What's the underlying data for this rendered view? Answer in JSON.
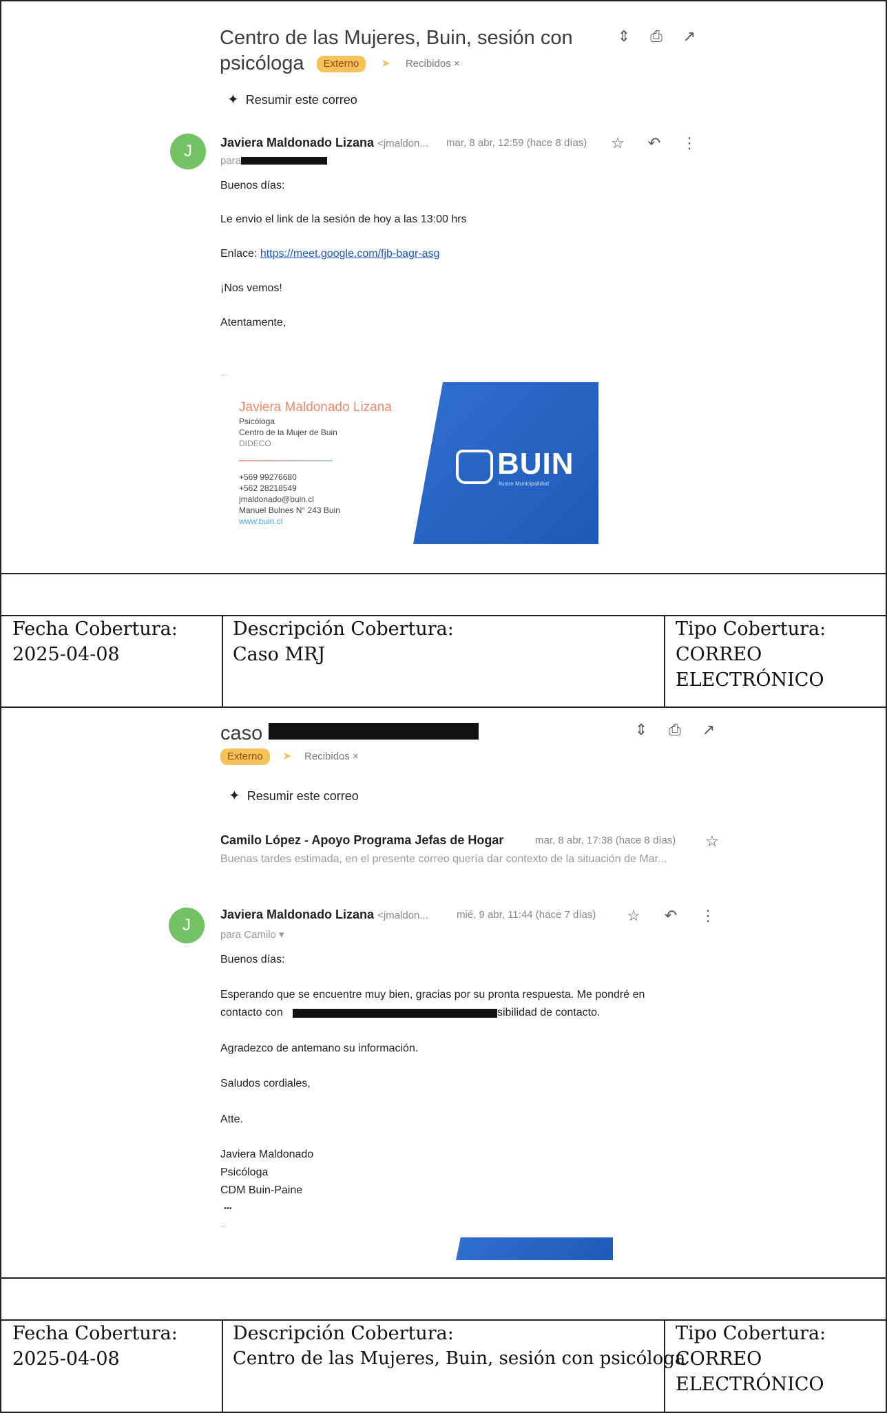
{
  "email1": {
    "subject_line1": "Centro de las Mujeres, Buin, sesión con",
    "subject_line2": "psicóloga",
    "label_external": "Externo",
    "label_inbox": "Recibidos ×",
    "summarize": "Resumir este correo",
    "avatar_letter": "J",
    "sender_name": "Javiera Maldonado Lizana",
    "sender_addr": "<jmaldon...",
    "date": "mar, 8 abr, 12:59 (hace 8 días)",
    "to_prefix": "para",
    "greeting": "Buenos días:",
    "line1": "Le envio el link de la sesión de hoy a las 13:00 hrs",
    "link_prefix": "Enlace: ",
    "link": "https://meet.google.com/fjb-bagr-asg",
    "line2": "¡Nos vemos!",
    "closing": "Atentamente,",
    "ellipsis": "...",
    "signature": {
      "name": "Javiera Maldonado Lizana",
      "title": "Psicóloga",
      "org": "Centro de la Mujer de Buin",
      "dept": "DIDECO",
      "phone1": "+569 99276680",
      "phone2": "+562 28218549",
      "email": "jmaldonado@buin.cl",
      "address": "Manuel Bulnes N° 243 Buin",
      "web": "www.buin.cl",
      "banner_text": "BUIN",
      "banner_sub": "Ilustre Municipalidad"
    }
  },
  "coverage1": {
    "fecha_label": "Fecha Cobertura:",
    "fecha_value": "2025-04-08",
    "desc_label": "Descripción Cobertura:",
    "desc_value": "Caso MRJ",
    "tipo_label": "Tipo Cobertura:",
    "tipo_value_1": "CORREO",
    "tipo_value_2": "ELECTRÓNICO"
  },
  "email2": {
    "subject": "caso",
    "label_external": "Externo",
    "label_inbox": "Recibidos ×",
    "summarize": "Resumir este correo",
    "prev_sender": "Camilo López - Apoyo Programa Jefas de Hogar",
    "prev_date": "mar, 8 abr, 17:38 (hace 8 días)",
    "prev_preview": "Buenas tardes estimada, en el presente correo quería dar contexto de la situación de Mar...",
    "avatar_letter": "J",
    "sender_name": "Javiera Maldonado Lizana",
    "sender_addr": "<jmaldon...",
    "date": "mié, 9 abr, 11:44 (hace 7 días)",
    "to": "para Camilo ▾",
    "greeting": "Buenos días:",
    "line1": "Esperando que se encuentre muy bien, gracias por su pronta respuesta. Me pondré en",
    "line2_start": "contacto con",
    "line2_end": "sibilidad de contacto.",
    "line3": "Agradezco de antemano su información.",
    "line4": "Saludos cordiales,",
    "line5": "Atte.",
    "sig1": "Javiera Maldonado",
    "sig2": "Psicóloga",
    "sig3": "CDM Buin-Paine",
    "dots": "•••",
    "ellipsis": "..."
  },
  "coverage2": {
    "fecha_label": "Fecha Cobertura:",
    "fecha_value": "2025-04-08",
    "desc_label": "Descripción Cobertura:",
    "desc_value": "Centro de las Mujeres, Buin, sesión con psicóloga",
    "tipo_label": "Tipo Cobertura:",
    "tipo_value_1": "CORREO",
    "tipo_value_2": "ELECTRÓNICO"
  },
  "icons": [
    "expand-icon",
    "print-icon",
    "open-new-window-icon",
    "star-icon",
    "reply-icon",
    "more-vert-icon",
    "sparkle-icon"
  ],
  "colors": {
    "external_chip": "#f6c25a",
    "avatar": "#73c365",
    "link": "#1a57c8",
    "banner": "#2f6fd0"
  }
}
